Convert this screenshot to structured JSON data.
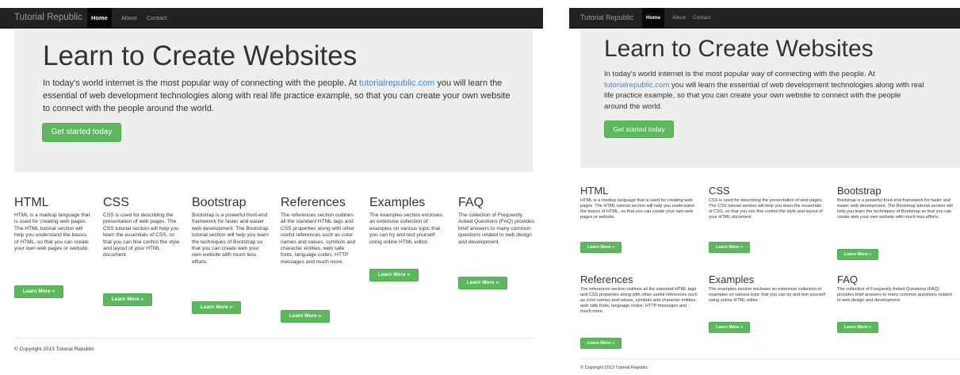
{
  "left": {
    "nav": {
      "brand": "Tutorial Republic",
      "items": [
        {
          "label": "Home"
        },
        {
          "label": "About"
        },
        {
          "label": "Contact"
        }
      ]
    },
    "hero": {
      "title": "Learn to Create Websites",
      "text_before": "In today's world internet is the most popular way of connecting with the people. At ",
      "link": "tutorialrepublic.com",
      "text_after": " you will learn the essential of web development technologies along with real life practice example, so that you can create your own website to connect with the people around the world.",
      "button": "Get started today"
    },
    "sections": [
      {
        "title": "HTML",
        "text": "HTML is a markup language that is used for creating web pages. The HTML tutorial section will help you understand the basics of HTML, so that you can create your own web pages or website.",
        "button": "Learn More »"
      },
      {
        "title": "CSS",
        "text": "CSS is used for describing the presentation of web pages. The CSS tutorial section will help you learn the essentials of CSS, so that you can fine control the style and layout of your HTML document.",
        "button": "Learn More »"
      },
      {
        "title": "Bootstrap",
        "text": "Bootstrap is a powerful front-end framework for faster and easier web development. The Bootstrap tutorial section will help you learn the techniques of Bootstrap so that you can create web your own website with much less efforts.",
        "button": "Learn More »"
      },
      {
        "title": "References",
        "text": "The references section outlines all the standard HTML tags and CSS properties along with other useful references such as color names and values, symbols and character entities, web safe fonts, language codes, HTTP messages and much more.",
        "button": "Learn More »"
      },
      {
        "title": "Examples",
        "text": "The examples section encloses an extensive collection of examples on various topic that you can try and test yourself using online HTML editor.",
        "button": "Learn More »"
      },
      {
        "title": "FAQ",
        "text": "The collection of Frequently Asked Questions (FAQ) provides brief answers to many common questions related to web design and development.",
        "button": "Learn More »"
      }
    ],
    "footer": "© Copyright 2013 Tutorial Republic"
  },
  "right": {
    "nav": {
      "brand": "Tutorial Republic",
      "items": [
        {
          "label": "Home"
        },
        {
          "label": "About"
        },
        {
          "label": "Contact"
        }
      ]
    },
    "hero": {
      "title": "Learn to Create Websites",
      "text_before": "In today's world internet is the most popular way of connecting with the people. At ",
      "link": "tutorialrepublic.com",
      "text_after": " you will learn the essential of web development technologies along with real life practice example, so that you can create your own website to connect with the people around the world.",
      "button": "Get started today"
    },
    "sections": [
      {
        "title": "HTML",
        "text": "HTML is a markup language that is used for creating web pages. The HTML tutorial section will help you understand the basics of HTML, so that you can create your own web pages or website.",
        "button": "Learn More »"
      },
      {
        "title": "CSS",
        "text": "CSS is used for describing the presentation of web pages. The CSS tutorial section will help you learn the essentials of CSS, so that you can fine control the style and layout of your HTML document.",
        "button": "Learn More »"
      },
      {
        "title": "Bootstrap",
        "text": "Bootstrap is a powerful front-end framework for faster and easier web development. The Bootstrap tutorial section will help you learn the techniques of Bootstrap so that you can create web your own website with much less efforts.",
        "button": "Learn More »"
      },
      {
        "title": "References",
        "text": "The references section outlines all the standard HTML tags and CSS properties along with other useful references such as color names and values, symbols and character entities, web safe fonts, language codes, HTTP messages and much more.",
        "button": "Learn More »"
      },
      {
        "title": "Examples",
        "text": "The examples section encloses an extensive collection of examples on various topic that you can try and test yourself using online HTML editor.",
        "button": "Learn More »"
      },
      {
        "title": "FAQ",
        "text": "The collection of Frequently Asked Questions (FAQ) provides brief answers to many common questions related to web design and development.",
        "button": "Learn More »"
      }
    ],
    "footer": "© Copyright 2013 Tutorial Republic"
  },
  "colors": {
    "navbar": "#222222",
    "jumbotron": "#eeeeee",
    "button": "#5cb85c",
    "link": "#428bca"
  }
}
